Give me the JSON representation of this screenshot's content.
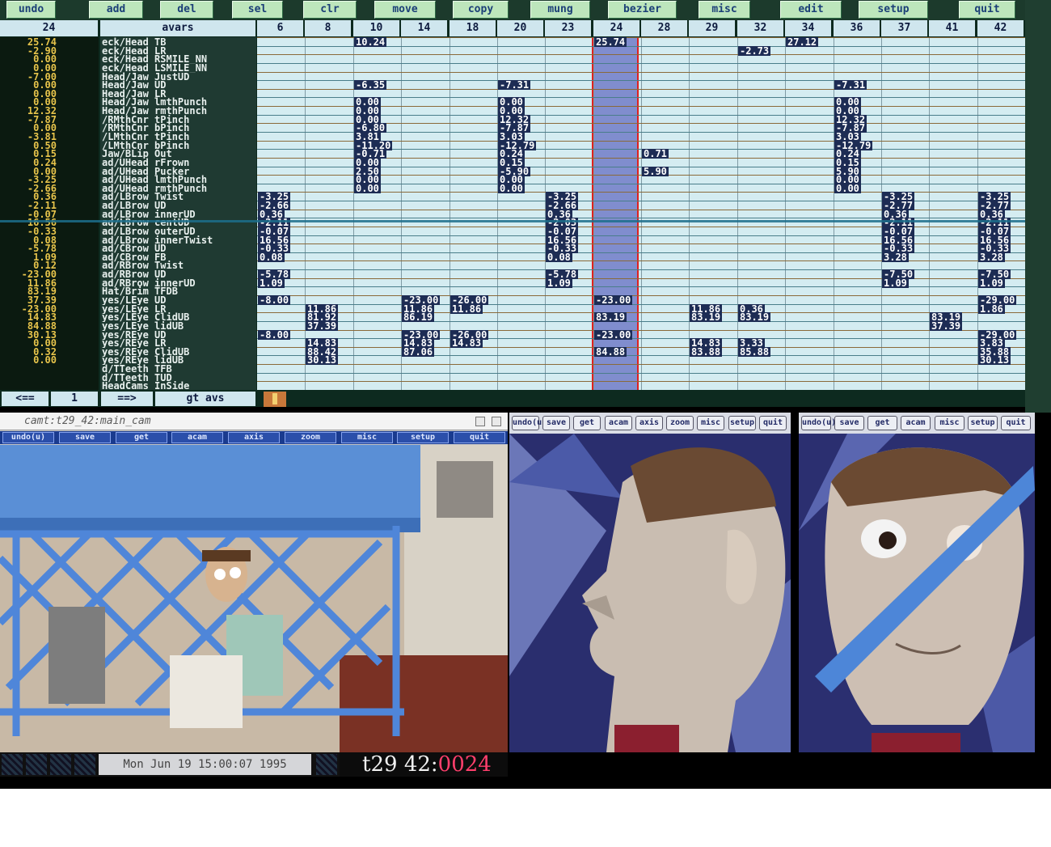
{
  "toolbar": {
    "buttons": [
      "undo",
      "add",
      "del",
      "sel",
      "clr",
      "move",
      "copy",
      "mung",
      "bezier",
      "misc",
      "edit",
      "setup",
      "quit"
    ]
  },
  "sheet": {
    "current_frame": "24",
    "avars_header": "avars",
    "frame_columns": [
      "6",
      "8",
      "10",
      "14",
      "18",
      "20",
      "23",
      "24",
      "28",
      "29",
      "32",
      "34",
      "36",
      "37",
      "41",
      "42"
    ],
    "left_values": [
      "25.74",
      "-2.90",
      "0.00",
      "0.00",
      "-7.00",
      "0.00",
      "0.00",
      "0.00",
      "12.32",
      "-7.87",
      "0.00",
      "-3.81",
      "0.50",
      "0.15",
      "0.24",
      "0.00",
      "-3.25",
      "-2.66",
      "0.36",
      "-2.11",
      "-0.07",
      "16.56",
      "-0.33",
      "0.08",
      "-5.78",
      "1.09",
      "0.12",
      "-23.00",
      "11.86",
      "83.19",
      "37.39",
      "-23.00",
      "14.83",
      "84.88",
      "30.13",
      "0.00",
      "0.32",
      "0.00"
    ],
    "avar_names": [
      "eck/Head  TB",
      "eck/Head  LR",
      "eck/Head  RSMILE_NN",
      "eck/Head  LSMILE_NN",
      "Head/Jaw  JustUD",
      "Head/Jaw  UD",
      "Head/Jaw  LR",
      "Head/Jaw  lmthPunch",
      "Head/Jaw  rmthPunch",
      "/RMthCnr  tPinch",
      "/RMthCnr  bPinch",
      "/LMthCnr  tPinch",
      "/LMthCnr  bPinch",
      "Jaw/BLip  Out",
      "ad/UHead  rFrown",
      "ad/UHead  Pucker",
      "ad/UHead  lmthPunch",
      "ad/UHead  rmthPunch",
      "ad/LBrow  Twist",
      "ad/LBrow  UD",
      "ad/LBrow  innerUD",
      "ad/LBrow  centUD",
      "ad/LBrow  outerUD",
      "ad/LBrow  innerTwist",
      "ad/CBrow  UD",
      "ad/CBrow  FB",
      "ad/RBrow  Twist",
      "ad/RBrow  UD",
      "ad/RBrow  innerUD",
      "Hat/Brim  TFDB",
      "yes/LEye  UD",
      "yes/LEye  LR",
      "yes/LEye  ClidUB",
      "yes/LEye  lidUB",
      "yes/REye  UD",
      "yes/REye  LR",
      "yes/REye  ClidUB",
      "yes/REye  lidUB",
      "d/TTeeth  TFB",
      "d/TTeeth  TUD",
      "HeadCams  InSide"
    ],
    "cells": [
      {
        "r": 0,
        "c": 2,
        "v": "10.24"
      },
      {
        "r": 0,
        "c": 7,
        "v": "25.74"
      },
      {
        "r": 0,
        "c": 11,
        "v": "27.12"
      },
      {
        "r": 1,
        "c": 10,
        "v": "-2.73"
      },
      {
        "r": 5,
        "c": 2,
        "v": "-6.35"
      },
      {
        "r": 5,
        "c": 5,
        "v": "-7.31"
      },
      {
        "r": 5,
        "c": 12,
        "v": "-7.31"
      },
      {
        "r": 7,
        "c": 2,
        "v": "0.00"
      },
      {
        "r": 7,
        "c": 5,
        "v": "0.00"
      },
      {
        "r": 7,
        "c": 12,
        "v": "0.00"
      },
      {
        "r": 8,
        "c": 2,
        "v": "0.00"
      },
      {
        "r": 8,
        "c": 5,
        "v": "0.00"
      },
      {
        "r": 8,
        "c": 12,
        "v": "0.00"
      },
      {
        "r": 9,
        "c": 2,
        "v": "0.00"
      },
      {
        "r": 9,
        "c": 5,
        "v": "12.32"
      },
      {
        "r": 9,
        "c": 12,
        "v": "12.32"
      },
      {
        "r": 10,
        "c": 2,
        "v": "-6.80"
      },
      {
        "r": 10,
        "c": 5,
        "v": "-7.87"
      },
      {
        "r": 10,
        "c": 12,
        "v": "-7.87"
      },
      {
        "r": 11,
        "c": 2,
        "v": "3.81"
      },
      {
        "r": 11,
        "c": 5,
        "v": "3.03"
      },
      {
        "r": 11,
        "c": 12,
        "v": "3.03"
      },
      {
        "r": 12,
        "c": 2,
        "v": "-11.20"
      },
      {
        "r": 12,
        "c": 5,
        "v": "-12.79"
      },
      {
        "r": 12,
        "c": 12,
        "v": "-12.79"
      },
      {
        "r": 13,
        "c": 2,
        "v": "-0.71"
      },
      {
        "r": 13,
        "c": 5,
        "v": "0.24"
      },
      {
        "r": 13,
        "c": 8,
        "v": "0.71"
      },
      {
        "r": 13,
        "c": 12,
        "v": "0.24"
      },
      {
        "r": 14,
        "c": 2,
        "v": "0.00"
      },
      {
        "r": 14,
        "c": 5,
        "v": "0.15"
      },
      {
        "r": 14,
        "c": 12,
        "v": "0.15"
      },
      {
        "r": 15,
        "c": 2,
        "v": "2.50"
      },
      {
        "r": 15,
        "c": 5,
        "v": "-5.90"
      },
      {
        "r": 15,
        "c": 8,
        "v": "5.90"
      },
      {
        "r": 15,
        "c": 12,
        "v": "5.90"
      },
      {
        "r": 16,
        "c": 2,
        "v": "0.00"
      },
      {
        "r": 16,
        "c": 5,
        "v": "0.00"
      },
      {
        "r": 16,
        "c": 12,
        "v": "0.00"
      },
      {
        "r": 17,
        "c": 2,
        "v": "0.00"
      },
      {
        "r": 17,
        "c": 5,
        "v": "0.00"
      },
      {
        "r": 17,
        "c": 12,
        "v": "0.00"
      },
      {
        "r": 18,
        "c": 0,
        "v": "-3.25"
      },
      {
        "r": 18,
        "c": 6,
        "v": "-3.25"
      },
      {
        "r": 18,
        "c": 13,
        "v": "-3.25"
      },
      {
        "r": 18,
        "c": 15,
        "v": "-3.25"
      },
      {
        "r": 19,
        "c": 0,
        "v": "-2.66"
      },
      {
        "r": 19,
        "c": 6,
        "v": "-2.66"
      },
      {
        "r": 19,
        "c": 13,
        "v": "-2.77"
      },
      {
        "r": 19,
        "c": 15,
        "v": "-2.77"
      },
      {
        "r": 20,
        "c": 0,
        "v": "0.36"
      },
      {
        "r": 20,
        "c": 6,
        "v": "0.36"
      },
      {
        "r": 20,
        "c": 13,
        "v": "0.36"
      },
      {
        "r": 20,
        "c": 15,
        "v": "0.36"
      },
      {
        "r": 21,
        "c": 0,
        "v": "-2.11"
      },
      {
        "r": 21,
        "c": 6,
        "v": "-2.03"
      },
      {
        "r": 21,
        "c": 13,
        "v": "-2.11"
      },
      {
        "r": 21,
        "c": 15,
        "v": "-2.11"
      },
      {
        "r": 22,
        "c": 0,
        "v": "-0.07"
      },
      {
        "r": 22,
        "c": 6,
        "v": "-0.07"
      },
      {
        "r": 22,
        "c": 13,
        "v": "-0.07"
      },
      {
        "r": 22,
        "c": 15,
        "v": "-0.07"
      },
      {
        "r": 23,
        "c": 0,
        "v": "16.56"
      },
      {
        "r": 23,
        "c": 6,
        "v": "16.56"
      },
      {
        "r": 23,
        "c": 13,
        "v": "16.56"
      },
      {
        "r": 23,
        "c": 15,
        "v": "16.56"
      },
      {
        "r": 24,
        "c": 0,
        "v": "-0.33"
      },
      {
        "r": 24,
        "c": 6,
        "v": "-0.33"
      },
      {
        "r": 24,
        "c": 13,
        "v": "-0.33"
      },
      {
        "r": 24,
        "c": 15,
        "v": "-0.33"
      },
      {
        "r": 25,
        "c": 0,
        "v": "0.08"
      },
      {
        "r": 25,
        "c": 6,
        "v": "0.08"
      },
      {
        "r": 25,
        "c": 13,
        "v": "3.28"
      },
      {
        "r": 25,
        "c": 15,
        "v": "3.28"
      },
      {
        "r": 27,
        "c": 0,
        "v": "-5.78"
      },
      {
        "r": 27,
        "c": 6,
        "v": "-5.78"
      },
      {
        "r": 27,
        "c": 13,
        "v": "-7.50"
      },
      {
        "r": 27,
        "c": 15,
        "v": "-7.50"
      },
      {
        "r": 28,
        "c": 0,
        "v": "1.09"
      },
      {
        "r": 28,
        "c": 6,
        "v": "1.09"
      },
      {
        "r": 28,
        "c": 13,
        "v": "1.09"
      },
      {
        "r": 28,
        "c": 15,
        "v": "1.09"
      },
      {
        "r": 30,
        "c": 0,
        "v": "-8.00"
      },
      {
        "r": 30,
        "c": 3,
        "v": "-23.00"
      },
      {
        "r": 30,
        "c": 4,
        "v": "-26.00"
      },
      {
        "r": 30,
        "c": 7,
        "v": "-23.00"
      },
      {
        "r": 30,
        "c": 15,
        "v": "-29.00"
      },
      {
        "r": 31,
        "c": 1,
        "v": "11.86"
      },
      {
        "r": 31,
        "c": 3,
        "v": "11.86"
      },
      {
        "r": 31,
        "c": 4,
        "v": "11.86"
      },
      {
        "r": 31,
        "c": 9,
        "v": "11.86"
      },
      {
        "r": 31,
        "c": 10,
        "v": "0.36"
      },
      {
        "r": 31,
        "c": 15,
        "v": "1.86"
      },
      {
        "r": 32,
        "c": 1,
        "v": "81.92"
      },
      {
        "r": 32,
        "c": 3,
        "v": "86.19"
      },
      {
        "r": 32,
        "c": 7,
        "v": "83.19"
      },
      {
        "r": 32,
        "c": 9,
        "v": "83.19"
      },
      {
        "r": 32,
        "c": 10,
        "v": "83.19"
      },
      {
        "r": 32,
        "c": 14,
        "v": "83.19"
      },
      {
        "r": 33,
        "c": 1,
        "v": "37.39"
      },
      {
        "r": 33,
        "c": 14,
        "v": "37.39"
      },
      {
        "r": 34,
        "c": 0,
        "v": "-8.00"
      },
      {
        "r": 34,
        "c": 3,
        "v": "-23.00"
      },
      {
        "r": 34,
        "c": 4,
        "v": "-26.00"
      },
      {
        "r": 34,
        "c": 7,
        "v": "-23.00"
      },
      {
        "r": 34,
        "c": 15,
        "v": "-29.00"
      },
      {
        "r": 35,
        "c": 1,
        "v": "14.83"
      },
      {
        "r": 35,
        "c": 3,
        "v": "14.83"
      },
      {
        "r": 35,
        "c": 4,
        "v": "14.83"
      },
      {
        "r": 35,
        "c": 9,
        "v": "14.83"
      },
      {
        "r": 35,
        "c": 10,
        "v": "3.33"
      },
      {
        "r": 35,
        "c": 15,
        "v": "3.83"
      },
      {
        "r": 36,
        "c": 1,
        "v": "88.42"
      },
      {
        "r": 36,
        "c": 3,
        "v": "87.06"
      },
      {
        "r": 36,
        "c": 7,
        "v": "84.88"
      },
      {
        "r": 36,
        "c": 9,
        "v": "83.88"
      },
      {
        "r": 36,
        "c": 10,
        "v": "85.88"
      },
      {
        "r": 36,
        "c": 15,
        "v": "35.88"
      },
      {
        "r": 37,
        "c": 1,
        "v": "30.13"
      },
      {
        "r": 37,
        "c": 15,
        "v": "30.13"
      }
    ],
    "nav": {
      "prev": "<==",
      "frame": "1",
      "next": "==>",
      "goto": "gt avs"
    }
  },
  "camera": {
    "title": "camt:t29_42:main_cam",
    "buttons": [
      "undo(u)",
      "save",
      "get",
      "acam",
      "axis",
      "zoom",
      "misc",
      "setup",
      "quit"
    ]
  },
  "view_buttons": [
    "undo(u)",
    "save",
    "get",
    "acam",
    "axis",
    "zoom",
    "misc",
    "setup",
    "quit"
  ],
  "view2_buttons": [
    "undo(u)",
    "save",
    "get",
    "acam",
    "misc",
    "setup",
    "quit"
  ],
  "status": {
    "datetime": "Mon Jun 19 15:00:07 1995",
    "shot": "t29",
    "scene": "42:",
    "frame": "0024"
  },
  "colors": {
    "button_face": "#bde6bc",
    "button_text": "#1b3f77",
    "grid_bg": "#d4ecf1",
    "value_yellow": "#e7c44b",
    "current_frame_blue": "#3b3fb0",
    "current_frame_border": "#e02020",
    "frame_number_pink": "#ff3f6c"
  }
}
